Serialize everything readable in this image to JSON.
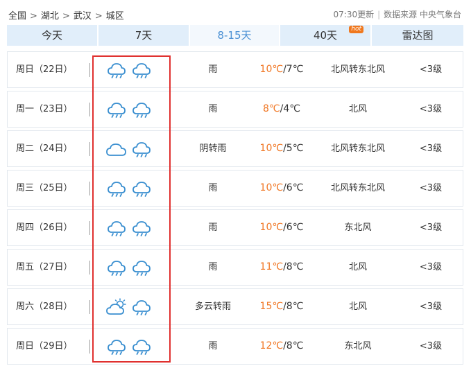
{
  "breadcrumb": {
    "items": [
      "全国",
      "湖北",
      "武汉",
      "城区"
    ],
    "separator": ">"
  },
  "header": {
    "update_time": "07:30更新",
    "source_label": "数据来源 中央气象台"
  },
  "tabs": [
    {
      "label": "今天",
      "active": false
    },
    {
      "label": "7天",
      "active": false
    },
    {
      "label": "8-15天",
      "active": true
    },
    {
      "label": "40天",
      "active": false,
      "badge": "hot"
    },
    {
      "label": "雷达图",
      "active": false
    }
  ],
  "forecast": [
    {
      "day": "周日（22日）",
      "icon_day": "rain-icon",
      "icon_night": "rain-icon",
      "desc": "雨",
      "high": "10℃",
      "low": "/7℃",
      "wind": "北风转东北风",
      "level": "<3级"
    },
    {
      "day": "周一（23日）",
      "icon_day": "rain-icon",
      "icon_night": "rain-icon",
      "desc": "雨",
      "high": "8℃",
      "low": "/4℃",
      "wind": "北风",
      "level": "<3级"
    },
    {
      "day": "周二（24日）",
      "icon_day": "overcast-icon",
      "icon_night": "rain-icon",
      "desc": "阴转雨",
      "high": "10℃",
      "low": "/5℃",
      "wind": "北风转东北风",
      "level": "<3级"
    },
    {
      "day": "周三（25日）",
      "icon_day": "rain-icon",
      "icon_night": "rain-icon",
      "desc": "雨",
      "high": "10℃",
      "low": "/6℃",
      "wind": "北风转东北风",
      "level": "<3级"
    },
    {
      "day": "周四（26日）",
      "icon_day": "rain-icon",
      "icon_night": "rain-icon",
      "desc": "雨",
      "high": "10℃",
      "low": "/6℃",
      "wind": "东北风",
      "level": "<3级"
    },
    {
      "day": "周五（27日）",
      "icon_day": "rain-icon",
      "icon_night": "rain-icon",
      "desc": "雨",
      "high": "11℃",
      "low": "/8℃",
      "wind": "北风",
      "level": "<3级"
    },
    {
      "day": "周六（28日）",
      "icon_day": "partly-cloudy-icon",
      "icon_night": "rain-icon",
      "desc": "多云转雨",
      "high": "15℃",
      "low": "/8℃",
      "wind": "北风",
      "level": "<3级"
    },
    {
      "day": "周日（29日）",
      "icon_day": "rain-icon",
      "icon_night": "rain-icon",
      "desc": "雨",
      "high": "12℃",
      "low": "/8℃",
      "wind": "东北风",
      "level": "<3级"
    }
  ],
  "colors": {
    "accent": "#4a90d4",
    "icon": "#3a8fd0",
    "temp_high": "#f07521",
    "highlight_box": "#e0302e",
    "hot_badge": "#f0781e"
  }
}
